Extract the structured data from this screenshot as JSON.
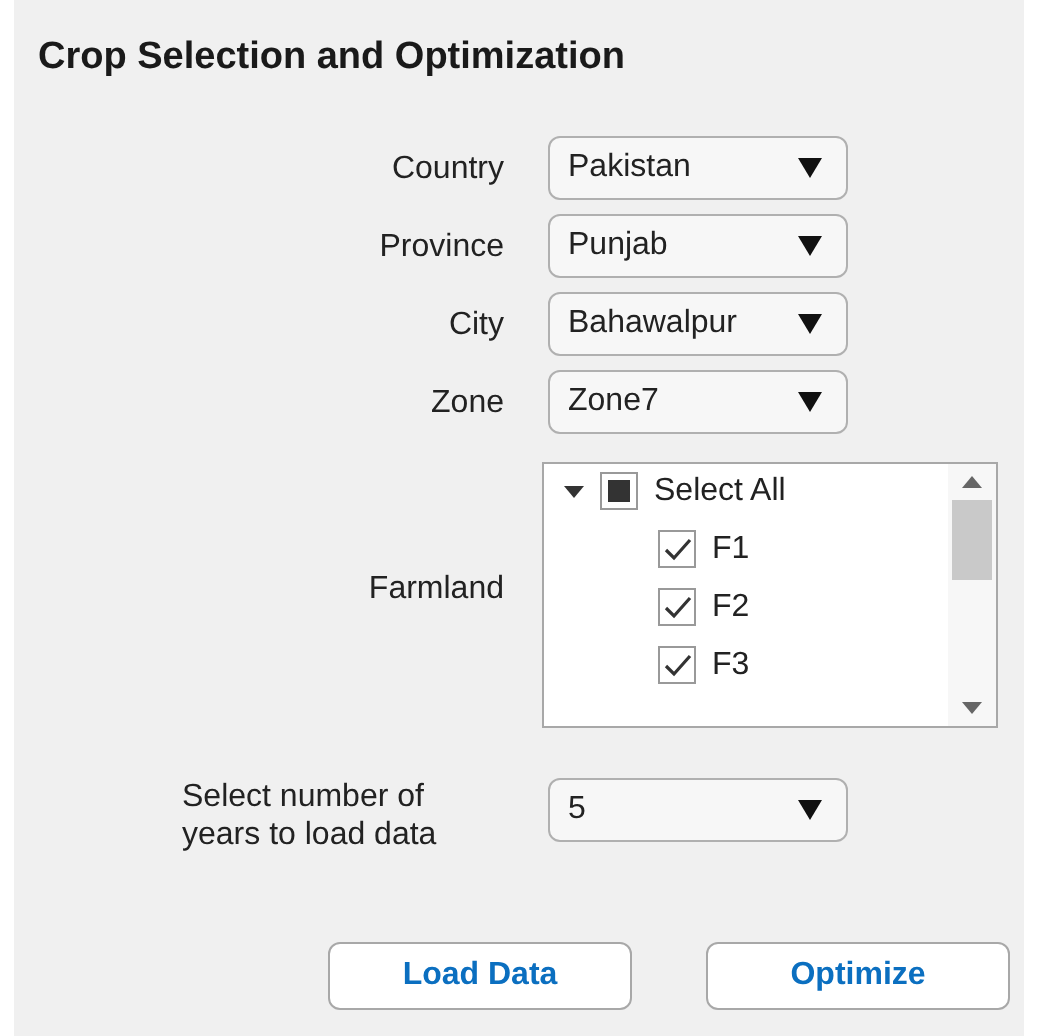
{
  "title": "Crop Selection and Optimization",
  "dropdowns": [
    {
      "label": "Country",
      "value": "Pakistan"
    },
    {
      "label": "Province",
      "value": "Punjab"
    },
    {
      "label": "City",
      "value": "Bahawalpur"
    },
    {
      "label": "Zone",
      "value": "Zone7"
    }
  ],
  "farmland": {
    "label": "Farmland",
    "tree": {
      "label": "Select All",
      "expanded": true,
      "mixed": true,
      "children": [
        {
          "label": "F1",
          "checked": true
        },
        {
          "label": "F2",
          "checked": true
        },
        {
          "label": "F3",
          "checked": true
        }
      ]
    }
  },
  "years": {
    "label": "Select number of years to load data",
    "value": "5"
  },
  "buttons": [
    "Load Data",
    "Optimize"
  ]
}
